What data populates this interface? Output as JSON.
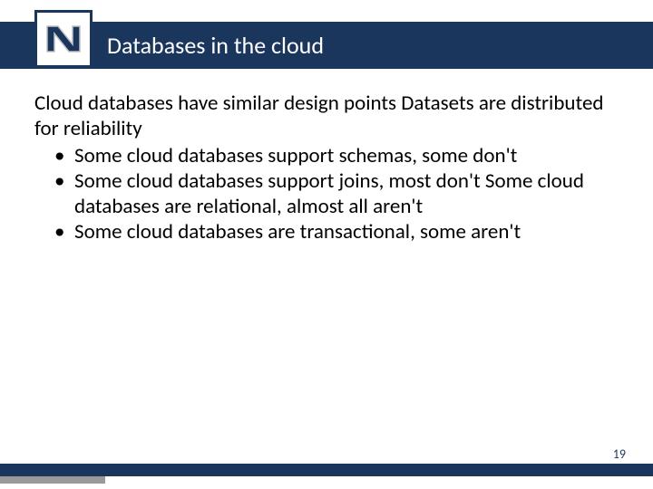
{
  "colors": {
    "brand": "#1b365d"
  },
  "header": {
    "title": "Databases in the cloud",
    "logo_letter": "N"
  },
  "body": {
    "lead": "Cloud databases have similar design points Datasets are distributed for reliability",
    "bullets": [
      "Some cloud databases support schemas, some don't",
      "Some cloud databases support joins, most don't Some cloud databases are relational, almost all aren't",
      "Some cloud databases are transactional, some aren't"
    ]
  },
  "footer": {
    "page_number": "19"
  }
}
